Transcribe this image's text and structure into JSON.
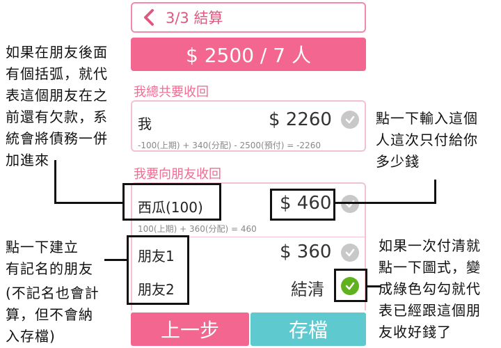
{
  "header": {
    "title": "3/3 結算"
  },
  "total": {
    "text": "$ 2500 / 7 人"
  },
  "receive_total": {
    "section_label": "我總共要收回",
    "name": "我",
    "amount": "$ 2260",
    "formula": "-100(上期) + 340(分配) - 2500(預付) = -2260"
  },
  "receive_from_friends": {
    "section_label": "我要向朋友收回",
    "rows": [
      {
        "name": "西瓜(100)",
        "amount": "$ 460",
        "formula": "100(上期) + 360(分配) = 460"
      },
      {
        "name": "朋友1",
        "amount": "$ 360"
      },
      {
        "name": "朋友2",
        "amount": "結清"
      }
    ]
  },
  "footer": {
    "prev_label": "上一步",
    "save_label": "存檔"
  },
  "annotations": {
    "left_top": [
      "如果在朋友後面",
      "有個括弧，就代",
      "表這個朋友在之",
      "前還有欠款，系",
      "統會將債務一併",
      "加進來"
    ],
    "left_bottom": [
      "點一下建立",
      "有記名的朋友"
    ],
    "left_bottom_paren": [
      "(不記名也會計",
      "算，但不會納",
      "入存檔)"
    ],
    "right_top": [
      "點一下輸入這個",
      "人這次只付給你",
      "多少錢"
    ],
    "right_bottom": [
      "如果一次付清就",
      "點一下圖式，變",
      "成綠色勾勾就代",
      "表已經跟這個朋",
      "友收好錢了"
    ]
  },
  "colors": {
    "pink": "#f2668f",
    "teal": "#5ec9cf",
    "green": "#5fb11d",
    "grey_check": "#c8c8c8"
  }
}
